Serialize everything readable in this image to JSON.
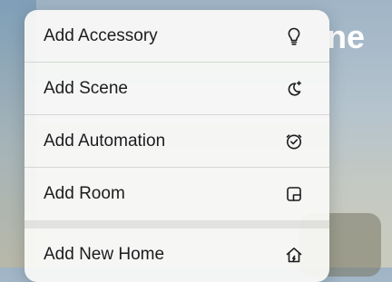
{
  "background": {
    "title_fragment": "ne"
  },
  "menu": {
    "items": [
      {
        "label": "Add Accessory",
        "icon": "lightbulb-icon"
      },
      {
        "label": "Add Scene",
        "icon": "scene-moon-icon"
      },
      {
        "label": "Add Automation",
        "icon": "automation-clock-icon"
      },
      {
        "label": "Add Room",
        "icon": "room-icon"
      },
      {
        "label": "Add New Home",
        "icon": "home-icon"
      }
    ]
  }
}
